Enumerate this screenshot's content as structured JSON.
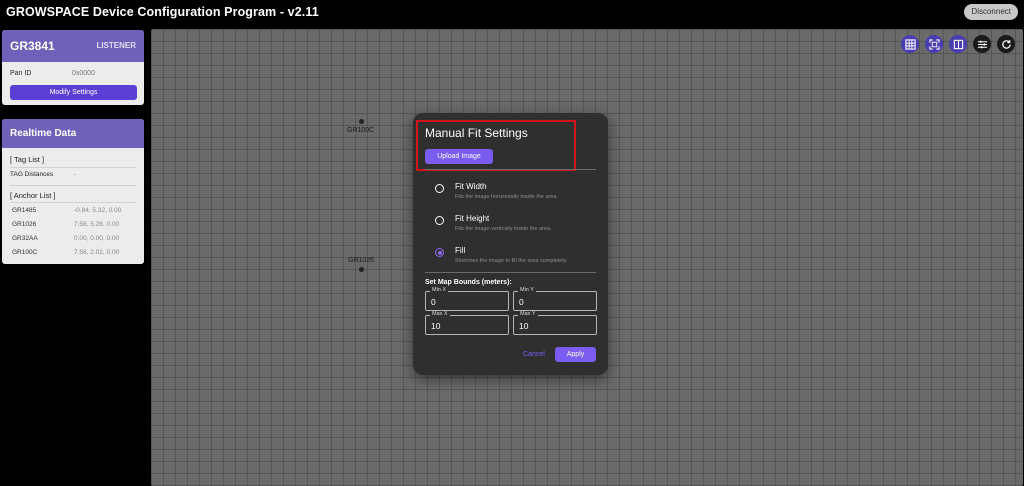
{
  "app": {
    "title": "GROWSPACE Device Configuration Program - v2.11",
    "disconnect_label": "Disconnect"
  },
  "device": {
    "name": "GR3841",
    "role": "LISTENER",
    "pan_label": "Pan ID",
    "pan_value": "0x0000",
    "modify_label": "Modify Settings"
  },
  "realtime": {
    "title": "Realtime Data",
    "tag_list_heading": "[ Tag List ]",
    "tag_distances_label": "TAG Distances",
    "tag_distances_value": "-",
    "anchor_list_heading": "[ Anchor List ]",
    "anchors": [
      {
        "id": "GR1485",
        "coords": "-0.84, 5.32, 0.00"
      },
      {
        "id": "GR1026",
        "coords": "7.58, 5.28, 0.00"
      },
      {
        "id": "GR32AA",
        "coords": "0.00, 0.00, 0.00"
      },
      {
        "id": "GR100C",
        "coords": "7.58, 2.02, 0.00"
      }
    ]
  },
  "map": {
    "anchor_labels": [
      "GR100C",
      "GR1026"
    ],
    "toolbar_icons": [
      "grid-icon",
      "fit-icon",
      "split-icon",
      "sliders-icon",
      "refresh-icon"
    ]
  },
  "modal": {
    "title": "Manual Fit Settings",
    "upload_label": "Upload Image",
    "options": [
      {
        "title": "Fit Width",
        "desc": "Fits the image horizontally inside the area.",
        "selected": false
      },
      {
        "title": "Fit Height",
        "desc": "Fits the image vertically inside the area.",
        "selected": false
      },
      {
        "title": "Fill",
        "desc": "Stretches the image to fill the area completely.",
        "selected": true
      }
    ],
    "bounds_title": "Set Map Bounds (meters):",
    "min_x_label": "Min X",
    "min_x_value": "0",
    "min_y_label": "Min Y",
    "min_y_value": "0",
    "max_x_label": "Max X",
    "max_x_value": "10",
    "max_y_label": "Max Y",
    "max_y_value": "10",
    "cancel_label": "Cancel",
    "apply_label": "Apply"
  },
  "colors": {
    "accent": "#7b5cf0",
    "header": "#6f60b9",
    "highlight": "#d0161c"
  }
}
